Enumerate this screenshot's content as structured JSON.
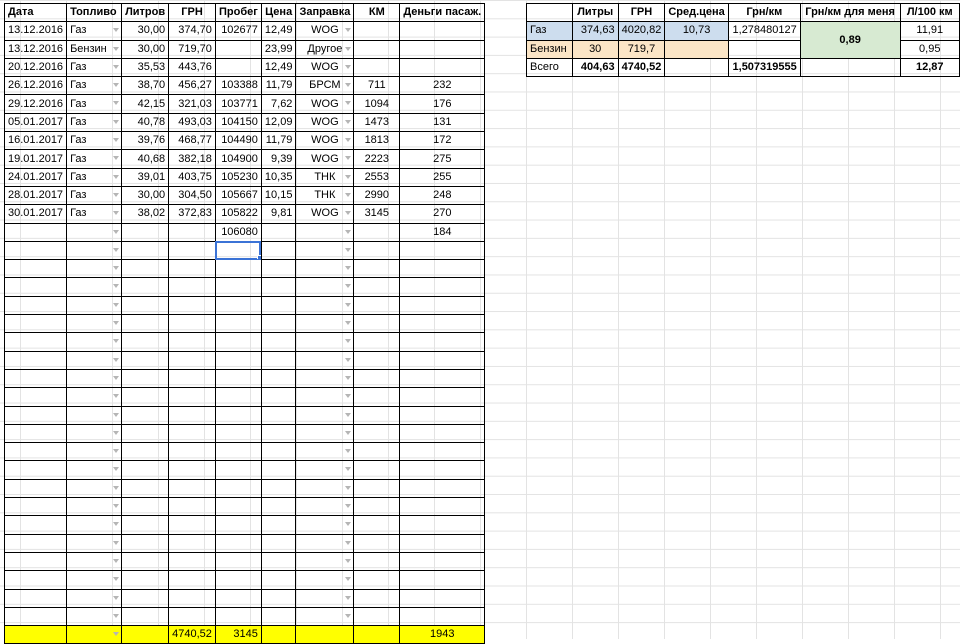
{
  "main_table": {
    "headers": [
      "Дата",
      "Топливо",
      "Литров",
      "ГРН",
      "Пробег",
      "Цена",
      "Заправка",
      "КМ",
      "Деньги пасаж."
    ],
    "rows": [
      [
        "13.12.2016",
        "Газ",
        "30,00",
        "374,70",
        "102677",
        "12,49",
        "WOG",
        "",
        ""
      ],
      [
        "13.12.2016",
        "Бензин",
        "30,00",
        "719,70",
        "",
        "23,99",
        "Другое",
        "",
        ""
      ],
      [
        "20.12.2016",
        "Газ",
        "35,53",
        "443,76",
        "",
        "12,49",
        "WOG",
        "",
        ""
      ],
      [
        "26.12.2016",
        "Газ",
        "38,70",
        "456,27",
        "103388",
        "11,79",
        "БРСМ",
        "711",
        "232"
      ],
      [
        "29.12.2016",
        "Газ",
        "42,15",
        "321,03",
        "103771",
        "7,62",
        "WOG",
        "1094",
        "176"
      ],
      [
        "05.01.2017",
        "Газ",
        "40,78",
        "493,03",
        "104150",
        "12,09",
        "WOG",
        "1473",
        "131"
      ],
      [
        "16.01.2017",
        "Газ",
        "39,76",
        "468,77",
        "104490",
        "11,79",
        "WOG",
        "1813",
        "172"
      ],
      [
        "19.01.2017",
        "Газ",
        "40,68",
        "382,18",
        "104900",
        "9,39",
        "WOG",
        "2223",
        "275"
      ],
      [
        "24.01.2017",
        "Газ",
        "39,01",
        "403,75",
        "105230",
        "10,35",
        "ТНК",
        "2553",
        "255"
      ],
      [
        "28.01.2017",
        "Газ",
        "30,00",
        "304,50",
        "105667",
        "10,15",
        "ТНК",
        "2990",
        "248"
      ],
      [
        "30.01.2017",
        "Газ",
        "38,02",
        "372,83",
        "105822",
        "9,81",
        "WOG",
        "3145",
        "270"
      ],
      [
        "",
        "",
        "",
        "",
        "106080",
        "",
        "",
        "",
        "184"
      ]
    ],
    "total_row": [
      "",
      "",
      "",
      "4740,52",
      "3145",
      "",
      "",
      "",
      "1943"
    ]
  },
  "summary_table": {
    "headers": [
      "",
      "Литры",
      "ГРН",
      "Сред.цена",
      "Грн/км",
      "Грн/км для меня",
      "Л/100 км"
    ],
    "gas_row": {
      "label": "Газ",
      "liters": "374,63",
      "uah": "4020,82",
      "avg_price": "10,73",
      "uah_per_km": "1,278480127",
      "l_per_100": "11,91"
    },
    "petrol_row": {
      "label": "Бензин",
      "liters": "30",
      "uah": "719,7",
      "l_per_100": "0,95"
    },
    "total_row": {
      "label": "Всего",
      "liters": "404,63",
      "uah": "4740,52",
      "uah_per_km": "1,507319555",
      "l_per_100": "12,87"
    },
    "uah_per_km_me": "0,89"
  },
  "colors": {
    "total_highlight": "#ffff00",
    "gas_row": "#cdddee",
    "petrol_row": "#fbe5c6",
    "merged_cell": "#d7ead2",
    "selection": "#3b73d6"
  }
}
